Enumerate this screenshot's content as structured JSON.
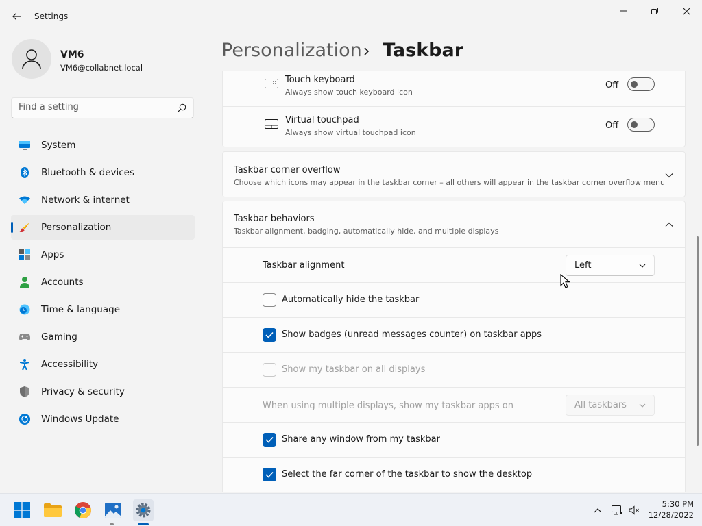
{
  "window": {
    "title": "Settings"
  },
  "profile": {
    "name": "VM6",
    "email": "VM6@collabnet.local"
  },
  "search": {
    "placeholder": "Find a setting"
  },
  "nav": {
    "items": [
      {
        "label": "System",
        "icon": "monitor-icon"
      },
      {
        "label": "Bluetooth & devices",
        "icon": "bluetooth-icon"
      },
      {
        "label": "Network & internet",
        "icon": "wifi-icon"
      },
      {
        "label": "Personalization",
        "icon": "brush-icon",
        "active": true
      },
      {
        "label": "Apps",
        "icon": "apps-icon"
      },
      {
        "label": "Accounts",
        "icon": "person-icon"
      },
      {
        "label": "Time & language",
        "icon": "clock-globe-icon"
      },
      {
        "label": "Gaming",
        "icon": "gamepad-icon"
      },
      {
        "label": "Accessibility",
        "icon": "accessibility-icon"
      },
      {
        "label": "Privacy & security",
        "icon": "shield-icon"
      },
      {
        "label": "Windows Update",
        "icon": "update-icon"
      }
    ]
  },
  "breadcrumb": {
    "parent": "Personalization",
    "separator": "›",
    "current": "Taskbar"
  },
  "system_tray_icons": {
    "touch_keyboard": {
      "title": "Touch keyboard",
      "subtitle": "Always show touch keyboard icon",
      "state": "Off"
    },
    "virtual_touchpad": {
      "title": "Virtual touchpad",
      "subtitle": "Always show virtual touchpad icon",
      "state": "Off"
    }
  },
  "corner_overflow": {
    "title": "Taskbar corner overflow",
    "subtitle": "Choose which icons may appear in the taskbar corner – all others will appear in the taskbar corner overflow menu"
  },
  "behaviors": {
    "title": "Taskbar behaviors",
    "subtitle": "Taskbar alignment, badging, automatically hide, and multiple displays",
    "alignment_label": "Taskbar alignment",
    "alignment_value": "Left",
    "auto_hide": {
      "label": "Automatically hide the taskbar",
      "checked": false
    },
    "badges": {
      "label": "Show badges (unread messages counter) on taskbar apps",
      "checked": true
    },
    "all_displays": {
      "label": "Show my taskbar on all displays",
      "checked": false,
      "disabled": true
    },
    "multi_display_label": "When using multiple displays, show my taskbar apps on",
    "multi_display_value": "All taskbars",
    "share_window": {
      "label": "Share any window from my taskbar",
      "checked": true
    },
    "far_corner": {
      "label": "Select the far corner of the taskbar to show the desktop",
      "checked": true
    }
  },
  "taskbar": {
    "apps": [
      "start-icon",
      "file-explorer-icon",
      "chrome-icon",
      "photos-icon",
      "settings-icon"
    ],
    "time": "5:30 PM",
    "date": "12/28/2022"
  },
  "colors": {
    "accent": "#005fb8",
    "background": "#f3f3f3",
    "card": "#fbfbfb"
  }
}
